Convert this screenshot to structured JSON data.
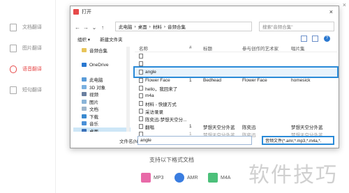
{
  "app": {
    "sidebar": [
      {
        "label": "文档翻译",
        "active": false
      },
      {
        "label": "图片翻译",
        "active": false
      },
      {
        "label": "语音翻译",
        "active": true
      },
      {
        "label": "短句翻译",
        "active": false
      }
    ],
    "close": "×",
    "formats_title": "支持以下格式文档",
    "formats": [
      "MP3",
      "AMR",
      "M4A"
    ],
    "watermark": "软件技巧"
  },
  "dialog": {
    "title": "打开",
    "close": "×",
    "nav": {
      "back": "←",
      "forward": "→",
      "dropdown": "⌄",
      "up": "↑"
    },
    "breadcrumb": [
      "此电脑",
      "桌面",
      "材料",
      "音频合集"
    ],
    "search_placeholder": "搜索\"音频合集\"",
    "toolbar": {
      "organize": "组织 ▾",
      "new_folder": "新建文件夹"
    },
    "help": "?",
    "nav_pane": [
      {
        "label": "音频合集",
        "selected": false
      },
      {
        "label": "",
        "selected": false
      },
      {
        "label": "OneDrive",
        "selected": false
      },
      {
        "label": "",
        "selected": false
      },
      {
        "label": "此电脑",
        "selected": false
      },
      {
        "label": "3D 对象",
        "selected": false
      },
      {
        "label": "视频",
        "selected": false
      },
      {
        "label": "图片",
        "selected": false
      },
      {
        "label": "文档",
        "selected": false
      },
      {
        "label": "下载",
        "selected": false
      },
      {
        "label": "音乐",
        "selected": false
      },
      {
        "label": "桌面",
        "selected": true
      }
    ],
    "columns": {
      "name": "名称",
      "num": "#",
      "title": "标题",
      "artist": "参与创作的艺术家",
      "album": "唱片集"
    },
    "files": [
      {
        "name": "",
        "num": "",
        "title": "",
        "artist": "",
        "album": "",
        "blur": true
      },
      {
        "name": "",
        "num": "",
        "title": "",
        "artist": "",
        "album": "",
        "blur": true
      },
      {
        "name": "angle",
        "num": "",
        "title": "",
        "artist": "",
        "album": "",
        "highlight": true
      },
      {
        "name": "Flower Face",
        "num": "1",
        "title": "Bedhead",
        "artist": "Flower Face",
        "album": "homesick"
      },
      {
        "name": "hello，我回来了",
        "num": "",
        "title": "",
        "artist": "",
        "album": ""
      },
      {
        "name": "m4a",
        "num": "",
        "title": "",
        "artist": "",
        "album": ""
      },
      {
        "name": "材料 - 快捷方式",
        "num": "",
        "title": "",
        "artist": "",
        "album": ""
      },
      {
        "name": "采访录录",
        "num": "",
        "title": "",
        "artist": "",
        "album": ""
      },
      {
        "name": "陈奕迅-梦想天空分...",
        "num": "",
        "title": "",
        "artist": "",
        "album": ""
      },
      {
        "name": "翻唱",
        "num": "1",
        "title": "梦想天空分外蓝",
        "artist": "陈奕迅",
        "album": "梦想天空分外蓝"
      },
      {
        "name": "",
        "num": "1",
        "title": "梦想天空分外蓝",
        "artist": "陈奕迅",
        "album": "梦想天空分外蓝",
        "blur": true
      }
    ],
    "filename_label": "文件名(N):",
    "filename_value": "angle",
    "filetype_value": "音频文件(*.amr,*.mp3,*.m4a,*."
  }
}
